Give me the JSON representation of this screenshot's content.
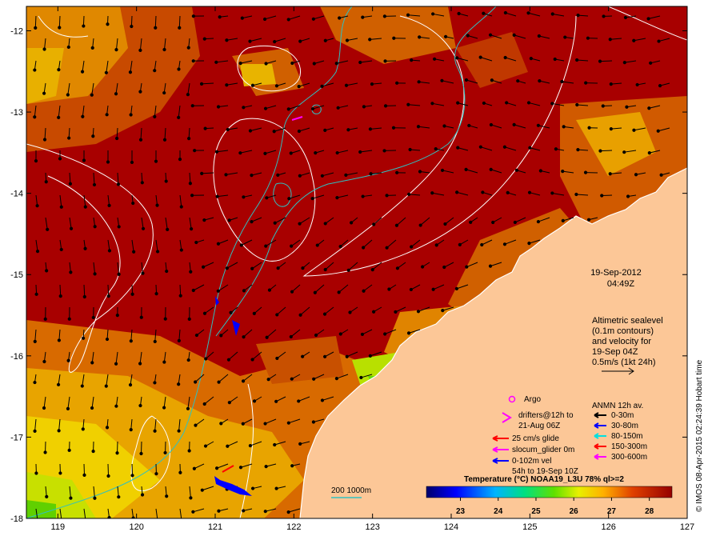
{
  "map": {
    "lon_ticks": [
      "119",
      "120",
      "121",
      "122",
      "123",
      "124",
      "125",
      "126",
      "127"
    ],
    "lat_ticks": [
      "-12",
      "-13",
      "-14",
      "-15",
      "-16",
      "-17",
      "-18"
    ],
    "lon_range": [
      118.6,
      127.0
    ],
    "lat_range": [
      -11.7,
      -18.0
    ]
  },
  "date": "19-Sep-2012",
  "time": "04:49Z",
  "altimetry_note": [
    "Altimetric sealevel",
    "(0.1m contours)",
    "and velocity for",
    "19-Sep 04Z",
    "0.5m/s (1kt 24h)"
  ],
  "legend": {
    "argo": "Argo",
    "drifters": [
      "drifters@12h to",
      "21-Aug 06Z"
    ],
    "glide": "25 cm/s glide",
    "slocum": "slocum_glider 0m",
    "vel": [
      "0-102m vel",
      "54h to 19-Sep 10Z"
    ],
    "anmn_title": "ANMN 12h av.",
    "anmn_items": [
      "0-30m",
      "30-80m",
      "80-150m",
      "150-300m",
      "300-600m"
    ],
    "anmn_colors": [
      "#000000",
      "#0000ff",
      "#00e0e0",
      "#ff0000",
      "#ff00ff"
    ]
  },
  "isobath_label": "200  1000m",
  "colorbar": {
    "title": "Temperature (°C) NOAA19_L3U 78% ql>=2",
    "ticks": [
      "23",
      "24",
      "25",
      "26",
      "27",
      "28"
    ],
    "range": [
      22.1,
      28.6
    ]
  },
  "credit": "© IMOS 08-Apr-2015 02:24:39 Hobart time"
}
